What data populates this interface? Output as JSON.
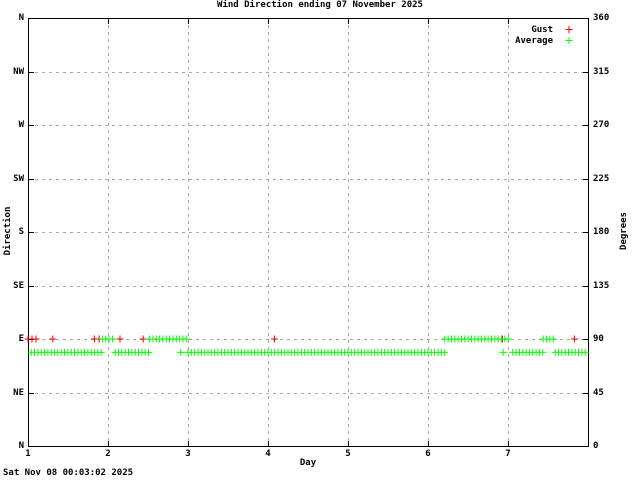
{
  "title": "Wind Direction ending 07 November 2025",
  "footer": {
    "timestamp": "Sat Nov 08 00:03:02 2025"
  },
  "colors": {
    "background": "#ffffff",
    "axis": "#000000",
    "grid": "#aaaaaa",
    "gust": "#ff0000",
    "average": "#00ff00"
  },
  "legend": {
    "position": "top-right",
    "entries": [
      {
        "label": "Gust",
        "color": "#ff0000",
        "marker": "plus"
      },
      {
        "label": "Average",
        "color": "#00ff00",
        "marker": "plus"
      }
    ]
  },
  "chart_data": {
    "type": "scatter",
    "title": "Wind Direction ending 07 November 2025",
    "xlabel": "Day",
    "ylabel": "Direction",
    "ylabel_right": "Degrees",
    "x_range": [
      1,
      8
    ],
    "y_range_degrees": [
      0,
      360
    ],
    "grid": true,
    "x_ticks": [
      "1",
      "2",
      "3",
      "4",
      "5",
      "6",
      "7"
    ],
    "y_ticks_left": [
      "N",
      "NW",
      "W",
      "SW",
      "S",
      "SE",
      "E",
      "NE",
      "N"
    ],
    "y_ticks_right": [
      "360",
      "315",
      "270",
      "225",
      "180",
      "135",
      "90",
      "45",
      "0"
    ],
    "sample_interval_days": 0.041667,
    "series": [
      {
        "name": "Gust",
        "color": "#ff0000",
        "marker": "plus",
        "points": [
          {
            "day": 1.0,
            "deg": 90
          },
          {
            "day": 1.05,
            "deg": 90
          },
          {
            "day": 1.1,
            "deg": 90
          },
          {
            "day": 1.31,
            "deg": 90
          },
          {
            "day": 1.83,
            "deg": 90
          },
          {
            "day": 1.89,
            "deg": 90
          },
          {
            "day": 2.15,
            "deg": 90
          },
          {
            "day": 2.44,
            "deg": 90
          },
          {
            "day": 4.08,
            "deg": 90
          },
          {
            "day": 6.93,
            "deg": 90
          },
          {
            "day": 7.83,
            "deg": 90
          }
        ]
      },
      {
        "name": "Average",
        "color": "#00ff00",
        "marker": "plus",
        "runs": [
          {
            "from_day": 1.04,
            "to_day": 1.94,
            "deg": 78.75
          },
          {
            "from_day": 2.09,
            "to_day": 2.53,
            "deg": 78.75
          },
          {
            "from_day": 3.0,
            "to_day": 6.21,
            "deg": 78.75
          },
          {
            "from_day": 7.06,
            "to_day": 7.44,
            "deg": 78.75
          },
          {
            "from_day": 7.59,
            "to_day": 7.99,
            "deg": 78.75
          },
          {
            "from_day": 1.93,
            "to_day": 2.06,
            "deg": 90
          },
          {
            "from_day": 2.52,
            "to_day": 2.98,
            "deg": 90
          },
          {
            "from_day": 6.21,
            "to_day": 7.03,
            "deg": 90
          },
          {
            "from_day": 7.44,
            "to_day": 7.58,
            "deg": 90
          }
        ],
        "points": [
          {
            "day": 2.91,
            "deg": 78.75
          },
          {
            "day": 6.94,
            "deg": 78.75
          }
        ]
      }
    ]
  }
}
